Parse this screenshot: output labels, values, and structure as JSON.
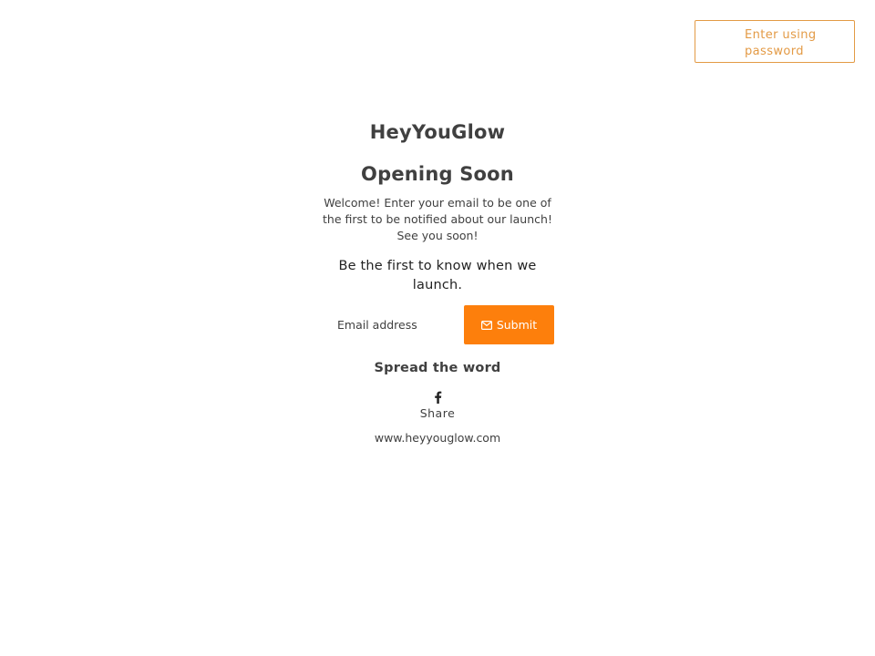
{
  "header": {
    "password_button_label": "Enter using password"
  },
  "main": {
    "brand": "HeyYouGlow",
    "title": "Opening Soon",
    "welcome_text": "Welcome! Enter your email to be one of the first to be notified about our launch! See you soon!",
    "signup_heading": "Be the first to know when we launch.",
    "email_placeholder": "Email address",
    "submit_label": "Submit",
    "share_heading": "Spread the word",
    "share_label": "Share",
    "site_url": "www.heyyouglow.com"
  },
  "icons": {
    "submit": "envelope-icon",
    "share": "facebook-icon"
  },
  "colors": {
    "accent": "#fd7f0c",
    "password_button": "#e39a45",
    "text": "#404040"
  }
}
